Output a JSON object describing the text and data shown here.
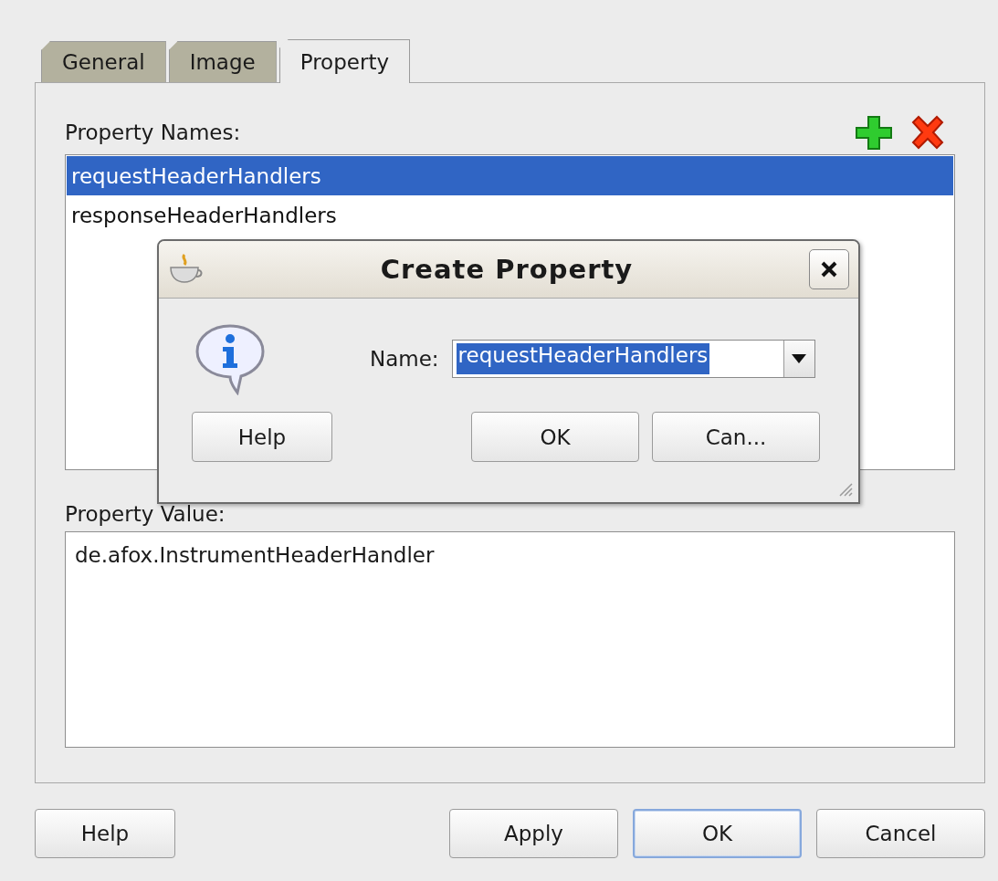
{
  "tabs": [
    {
      "label": "General",
      "selected": false
    },
    {
      "label": "Image",
      "selected": false
    },
    {
      "label": "Property",
      "selected": true
    }
  ],
  "property_names": {
    "label": "Property Names:",
    "items": [
      {
        "text": "requestHeaderHandlers",
        "selected": true
      },
      {
        "text": "responseHeaderHandlers",
        "selected": false
      }
    ]
  },
  "property_value": {
    "label": "Property Value:",
    "value": "de.afox.InstrumentHeaderHandler"
  },
  "dialog": {
    "title": "Create Property",
    "name_label": "Name:",
    "name_value": "requestHeaderHandlers",
    "value_selected": true,
    "buttons": [
      {
        "label": "Help"
      },
      {
        "label": "OK"
      },
      {
        "label": "Can..."
      }
    ]
  },
  "buttons": [
    {
      "label": "Help",
      "default": false
    },
    {
      "label": "Apply",
      "default": false
    },
    {
      "label": "OK",
      "default": true
    },
    {
      "label": "Cancel",
      "default": false
    }
  ]
}
